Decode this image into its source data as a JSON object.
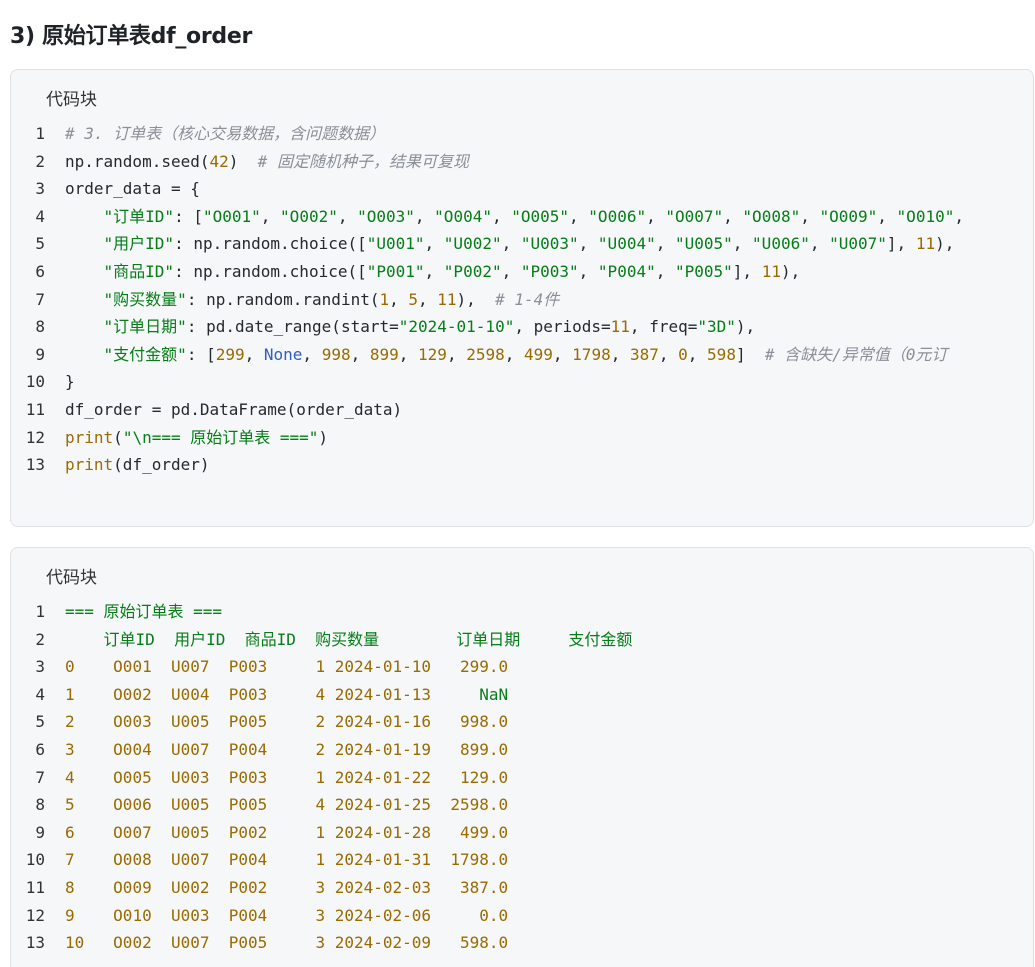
{
  "heading": "3) 原始订单表df_order",
  "blocks": [
    {
      "label": "代码块",
      "lines": [
        [
          [
            "cm",
            "# 3. 订单表（核心交易数据，含问题数据）"
          ]
        ],
        [
          [
            "pl",
            "np.random.seed("
          ],
          [
            "num",
            "42"
          ],
          [
            "pl",
            ")  "
          ],
          [
            "cm",
            "# 固定随机种子，结果可复现"
          ]
        ],
        [
          [
            "pl",
            "order_data = {"
          ]
        ],
        [
          [
            "pl",
            "    "
          ],
          [
            "str",
            "\"订单ID\""
          ],
          [
            "pl",
            ": ["
          ],
          [
            "str",
            "\"O001\""
          ],
          [
            "pl",
            ", "
          ],
          [
            "str",
            "\"O002\""
          ],
          [
            "pl",
            ", "
          ],
          [
            "str",
            "\"O003\""
          ],
          [
            "pl",
            ", "
          ],
          [
            "str",
            "\"O004\""
          ],
          [
            "pl",
            ", "
          ],
          [
            "str",
            "\"O005\""
          ],
          [
            "pl",
            ", "
          ],
          [
            "str",
            "\"O006\""
          ],
          [
            "pl",
            ", "
          ],
          [
            "str",
            "\"O007\""
          ],
          [
            "pl",
            ", "
          ],
          [
            "str",
            "\"O008\""
          ],
          [
            "pl",
            ", "
          ],
          [
            "str",
            "\"O009\""
          ],
          [
            "pl",
            ", "
          ],
          [
            "str",
            "\"O010\""
          ],
          [
            "pl",
            ","
          ]
        ],
        [
          [
            "pl",
            "    "
          ],
          [
            "str",
            "\"用户ID\""
          ],
          [
            "pl",
            ": np.random.choice(["
          ],
          [
            "str",
            "\"U001\""
          ],
          [
            "pl",
            ", "
          ],
          [
            "str",
            "\"U002\""
          ],
          [
            "pl",
            ", "
          ],
          [
            "str",
            "\"U003\""
          ],
          [
            "pl",
            ", "
          ],
          [
            "str",
            "\"U004\""
          ],
          [
            "pl",
            ", "
          ],
          [
            "str",
            "\"U005\""
          ],
          [
            "pl",
            ", "
          ],
          [
            "str",
            "\"U006\""
          ],
          [
            "pl",
            ", "
          ],
          [
            "str",
            "\"U007\""
          ],
          [
            "pl",
            "], "
          ],
          [
            "num",
            "11"
          ],
          [
            "pl",
            "),"
          ]
        ],
        [
          [
            "pl",
            "    "
          ],
          [
            "str",
            "\"商品ID\""
          ],
          [
            "pl",
            ": np.random.choice(["
          ],
          [
            "str",
            "\"P001\""
          ],
          [
            "pl",
            ", "
          ],
          [
            "str",
            "\"P002\""
          ],
          [
            "pl",
            ", "
          ],
          [
            "str",
            "\"P003\""
          ],
          [
            "pl",
            ", "
          ],
          [
            "str",
            "\"P004\""
          ],
          [
            "pl",
            ", "
          ],
          [
            "str",
            "\"P005\""
          ],
          [
            "pl",
            "], "
          ],
          [
            "num",
            "11"
          ],
          [
            "pl",
            "),"
          ]
        ],
        [
          [
            "pl",
            "    "
          ],
          [
            "str",
            "\"购买数量\""
          ],
          [
            "pl",
            ": np.random.randint("
          ],
          [
            "num",
            "1"
          ],
          [
            "pl",
            ", "
          ],
          [
            "num",
            "5"
          ],
          [
            "pl",
            ", "
          ],
          [
            "num",
            "11"
          ],
          [
            "pl",
            "),  "
          ],
          [
            "cm",
            "# 1-4件"
          ]
        ],
        [
          [
            "pl",
            "    "
          ],
          [
            "str",
            "\"订单日期\""
          ],
          [
            "pl",
            ": pd.date_range(start="
          ],
          [
            "str",
            "\"2024-01-10\""
          ],
          [
            "pl",
            ", periods="
          ],
          [
            "num",
            "11"
          ],
          [
            "pl",
            ", freq="
          ],
          [
            "str",
            "\"3D\""
          ],
          [
            "pl",
            "),"
          ]
        ],
        [
          [
            "pl",
            "    "
          ],
          [
            "str",
            "\"支付金额\""
          ],
          [
            "pl",
            ": ["
          ],
          [
            "num",
            "299"
          ],
          [
            "pl",
            ", "
          ],
          [
            "kw",
            "None"
          ],
          [
            "pl",
            ", "
          ],
          [
            "num",
            "998"
          ],
          [
            "pl",
            ", "
          ],
          [
            "num",
            "899"
          ],
          [
            "pl",
            ", "
          ],
          [
            "num",
            "129"
          ],
          [
            "pl",
            ", "
          ],
          [
            "num",
            "2598"
          ],
          [
            "pl",
            ", "
          ],
          [
            "num",
            "499"
          ],
          [
            "pl",
            ", "
          ],
          [
            "num",
            "1798"
          ],
          [
            "pl",
            ", "
          ],
          [
            "num",
            "387"
          ],
          [
            "pl",
            ", "
          ],
          [
            "num",
            "0"
          ],
          [
            "pl",
            ", "
          ],
          [
            "num",
            "598"
          ],
          [
            "pl",
            "]  "
          ],
          [
            "cm",
            "# 含缺失/异常值（0元订"
          ]
        ],
        [
          [
            "pl",
            "}"
          ]
        ],
        [
          [
            "pl",
            "df_order = pd.DataFrame(order_data)"
          ]
        ],
        [
          [
            "fn",
            "print"
          ],
          [
            "pl",
            "("
          ],
          [
            "str",
            "\"\\n=== 原始订单表 ===\""
          ],
          [
            "pl",
            ")"
          ]
        ],
        [
          [
            "fn",
            "print"
          ],
          [
            "pl",
            "(df_order)"
          ]
        ]
      ]
    },
    {
      "label": "代码块",
      "lines": [
        [
          [
            "out-str",
            "=== 原始订单表 ==="
          ]
        ],
        [
          [
            "out-str",
            "    订单ID  用户ID  商品ID  购买数量        订单日期     支付金额"
          ]
        ],
        [
          [
            "out-num",
            "0 "
          ],
          [
            "pl",
            "   "
          ],
          [
            "out-num",
            "O001  U007  P003     1 2024-01-10   299.0"
          ]
        ],
        [
          [
            "out-num",
            "1 "
          ],
          [
            "pl",
            "   "
          ],
          [
            "out-num",
            "O002  U004  P003     4 2024-01-13     "
          ],
          [
            "out-str",
            "NaN"
          ]
        ],
        [
          [
            "out-num",
            "2 "
          ],
          [
            "pl",
            "   "
          ],
          [
            "out-num",
            "O003  U005  P005     2 2024-01-16   998.0"
          ]
        ],
        [
          [
            "out-num",
            "3 "
          ],
          [
            "pl",
            "   "
          ],
          [
            "out-num",
            "O004  U007  P004     2 2024-01-19   899.0"
          ]
        ],
        [
          [
            "out-num",
            "4 "
          ],
          [
            "pl",
            "   "
          ],
          [
            "out-num",
            "O005  U003  P003     1 2024-01-22   129.0"
          ]
        ],
        [
          [
            "out-num",
            "5 "
          ],
          [
            "pl",
            "   "
          ],
          [
            "out-num",
            "O006  U005  P005     4 2024-01-25  2598.0"
          ]
        ],
        [
          [
            "out-num",
            "6 "
          ],
          [
            "pl",
            "   "
          ],
          [
            "out-num",
            "O007  U005  P002     1 2024-01-28   499.0"
          ]
        ],
        [
          [
            "out-num",
            "7 "
          ],
          [
            "pl",
            "   "
          ],
          [
            "out-num",
            "O008  U007  P004     1 2024-01-31  1798.0"
          ]
        ],
        [
          [
            "out-num",
            "8 "
          ],
          [
            "pl",
            "   "
          ],
          [
            "out-num",
            "O009  U002  P002     3 2024-02-03   387.0"
          ]
        ],
        [
          [
            "out-num",
            "9 "
          ],
          [
            "pl",
            "   "
          ],
          [
            "out-num",
            "O010  U003  P004     3 2024-02-06     0.0"
          ]
        ],
        [
          [
            "out-num",
            "10"
          ],
          [
            "pl",
            "   "
          ],
          [
            "out-num",
            "O002  U007  P005     3 2024-02-09   598.0"
          ]
        ]
      ]
    }
  ]
}
